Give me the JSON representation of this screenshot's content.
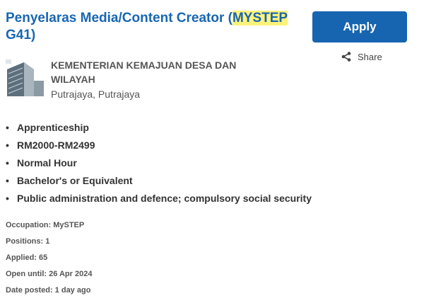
{
  "job": {
    "title_prefix": "Penyelaras Media/Content Creator (",
    "title_highlight": "MYSTEP",
    "title_suffix": " G41)"
  },
  "actions": {
    "apply_label": "Apply",
    "share_label": "Share"
  },
  "employer": {
    "name": "KEMENTERIAN KEMAJUAN DESA DAN WILAYAH",
    "location": "Putrajaya, Putrajaya"
  },
  "attributes": [
    "Apprenticeship",
    "RM2000-RM2499",
    "Normal Hour",
    "Bachelor's or Equivalent",
    "Public administration and defence; compulsory social security"
  ],
  "bullet": "•",
  "meta": {
    "occupation": "Occupation: MySTEP",
    "positions": "Positions: 1",
    "applied": "Applied: 65",
    "open_until": "Open until: 26 Apr 2024",
    "date_posted": "Date posted: 1 day ago"
  },
  "colors": {
    "brand_blue": "#1764b0",
    "title_blue": "#1866b3",
    "highlight": "#fff27a"
  },
  "icons": {
    "share": "share-icon",
    "logo": "building-logo"
  }
}
